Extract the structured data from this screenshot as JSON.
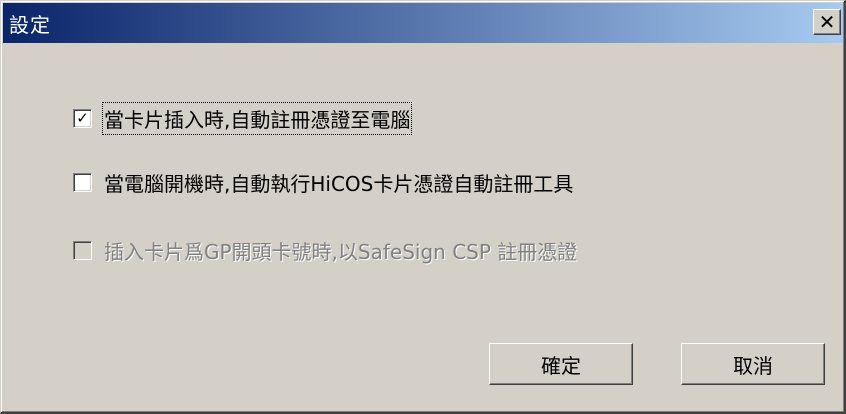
{
  "window": {
    "title": "設定",
    "titlebar_gradient": [
      "#0a246a",
      "#a6caf0"
    ],
    "close_glyph": "✕"
  },
  "options": [
    {
      "label": "當卡片插入時,自動註冊憑證至電腦",
      "checked": true,
      "enabled": true
    },
    {
      "label": "當電腦開機時,自動執行HiCOS卡片憑證自動註冊工具",
      "checked": false,
      "enabled": true
    },
    {
      "label": "插入卡片爲GP開頭卡號時,以SafeSign CSP 註冊憑證",
      "checked": false,
      "enabled": false
    }
  ],
  "buttons": {
    "ok_label": "確定",
    "cancel_label": "取消"
  },
  "check_glyph": "✓"
}
